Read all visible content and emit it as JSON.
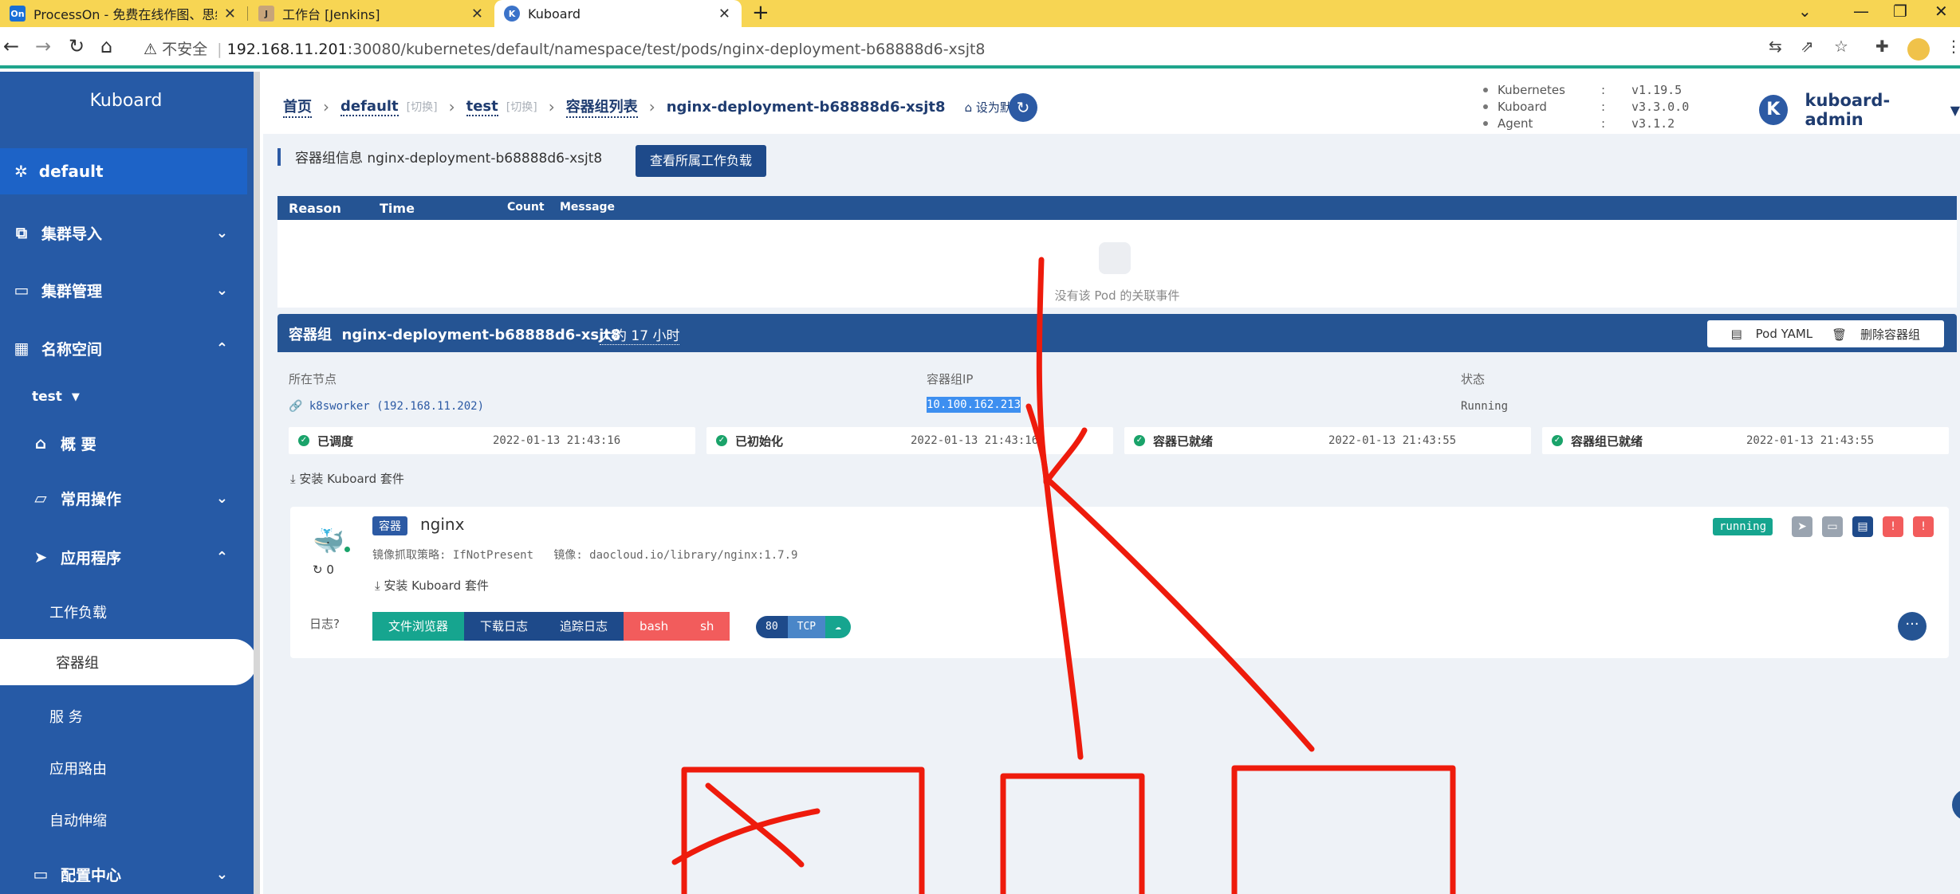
{
  "browser": {
    "tabs": [
      {
        "favicon": "On",
        "title": "ProcessOn - 免费在线作图、思维"
      },
      {
        "favicon": "J",
        "title": "工作台 [Jenkins]"
      },
      {
        "favicon": "K",
        "title": "Kuboard"
      }
    ],
    "new_tab": "+",
    "insecure_label": "不安全",
    "url_host": "192.168.11.201",
    "url_rest": ":30080/kubernetes/default/namespace/test/pods/nginx-deployment-b68888d6-xsjt8"
  },
  "sidebar": {
    "brand": "Kuboard",
    "cluster": "default",
    "items": [
      {
        "icon": "cluster-import-icon",
        "label": "集群导入"
      },
      {
        "icon": "cluster-manage-icon",
        "label": "集群管理"
      },
      {
        "icon": "namespace-icon",
        "label": "名称空间"
      }
    ],
    "namespace": "test",
    "overview": "概 要",
    "common_ops": "常用操作",
    "apps": "应用程序",
    "subs": [
      "工作负载",
      "容器组",
      "服 务",
      "应用路由",
      "自动伸缩"
    ],
    "config": "配置中心"
  },
  "breadcrumb": {
    "home": "首页",
    "cluster": "default",
    "ns": "test",
    "switch": "[切换]",
    "list": "容器组列表",
    "current": "nginx-deployment-b68888d6-xsjt8",
    "set_default": "设为默认页"
  },
  "versions": [
    {
      "name": "Kubernetes",
      "value": "v1.19.5"
    },
    {
      "name": "Kuboard",
      "value": "v3.3.0.0"
    },
    {
      "name": "Agent",
      "value": "v3.1.2"
    }
  ],
  "user": {
    "initial": "K",
    "name": "kuboard-admin"
  },
  "pod_info": {
    "title": "容器组信息 nginx-deployment-b68888d6-xsjt8",
    "view_workload": "查看所属工作负载"
  },
  "events": {
    "columns": [
      "Reason",
      "Time",
      "Count",
      "Message"
    ],
    "empty": "没有该 Pod 的关联事件"
  },
  "pod": {
    "label": "容器组",
    "name": "nginx-deployment-b68888d6-xsjt8",
    "age": "大约 17 小时",
    "yaml": "Pod YAML",
    "delete": "删除容器组",
    "node_label": "所在节点",
    "node_value": "k8sworker (192.168.11.202)",
    "ip_label": "容器组IP",
    "ip_value": "10.100.162.213",
    "status_label": "状态",
    "status_value": "Running",
    "conditions": [
      {
        "name": "已调度",
        "time": "2022-01-13 21:43:16"
      },
      {
        "name": "已初始化",
        "time": "2022-01-13 21:43:16"
      },
      {
        "name": "容器已就绪",
        "time": "2022-01-13 21:43:55"
      },
      {
        "name": "容器组已就绪",
        "time": "2022-01-13 21:43:55"
      }
    ],
    "install_suite": "安装 Kuboard 套件"
  },
  "container": {
    "tag": "容器",
    "name": "nginx",
    "restarts": "0",
    "pull_policy_label": "镜像抓取策略",
    "pull_policy": "IfNotPresent",
    "image_label": "镜像",
    "image": "daocloud.io/library/nginx:1.7.9",
    "install_suite": "安装 Kuboard 套件",
    "status": "running",
    "logs_label": "日志",
    "buttons": [
      "文件浏览器",
      "下载日志",
      "追踪日志",
      "bash",
      "sh"
    ],
    "port": "80",
    "protocol": "TCP",
    "colors": {
      "green": "#16a58f",
      "navy": "#1e4a8a",
      "red": "#f25c5c",
      "gray": "#9aa4b0"
    }
  }
}
